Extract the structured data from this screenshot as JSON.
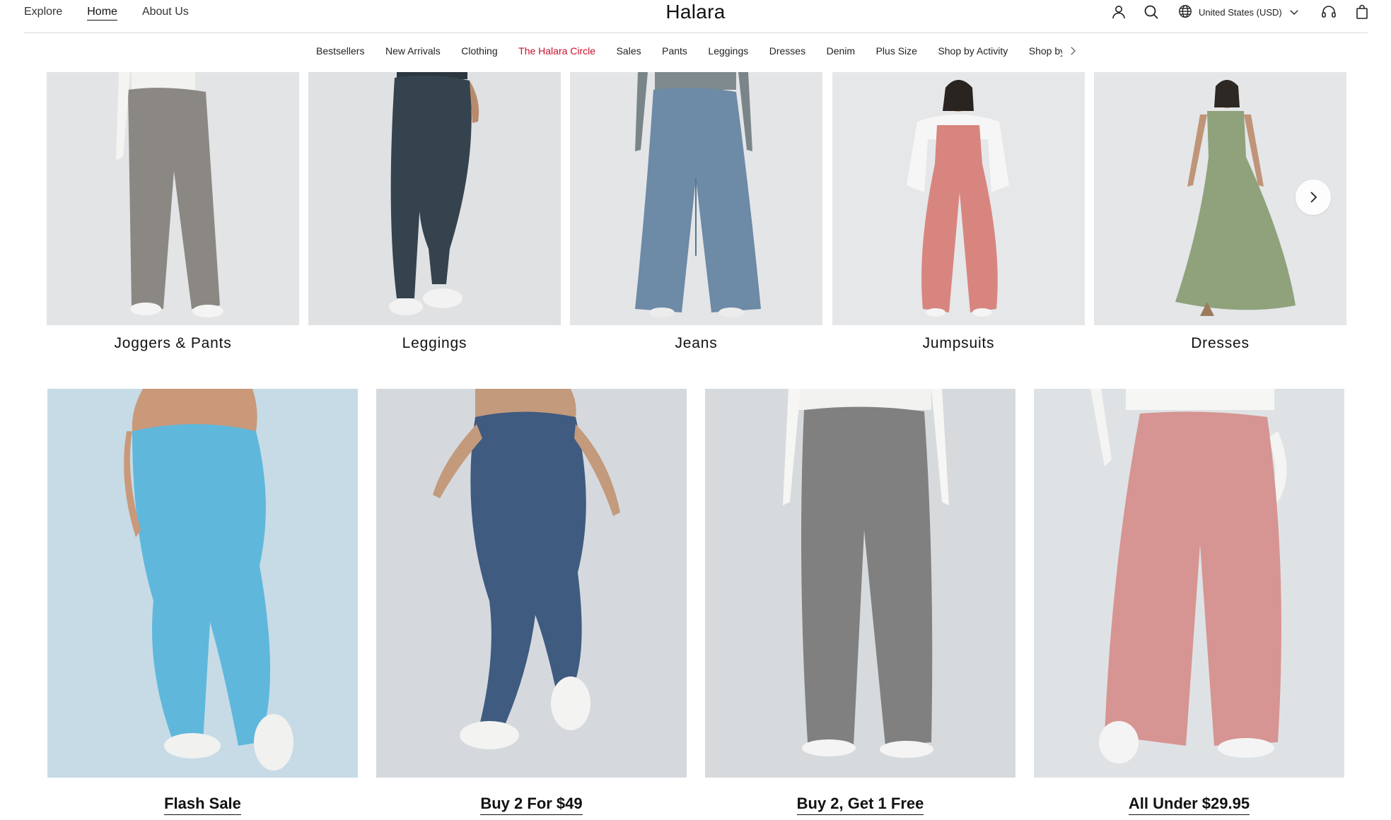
{
  "top_nav": {
    "links": [
      "Explore",
      "Home",
      "About Us"
    ],
    "active": "Home"
  },
  "brand": "Halara",
  "header_actions": {
    "account_icon": "person-icon",
    "search_icon": "search-icon",
    "region_icon": "globe-icon",
    "region_label": "United States (USD)",
    "region_chevron": "chevron-down-icon",
    "support_icon": "headset-icon",
    "cart_icon": "shopping-bag-icon"
  },
  "category_menu": {
    "items": [
      "Bestsellers",
      "New Arrivals",
      "Clothing",
      "The Halara Circle",
      "Sales",
      "Pants",
      "Leggings",
      "Dresses",
      "Denim",
      "Plus Size",
      "Shop by Activity",
      "Shop by"
    ],
    "highlighted": "The Halara Circle",
    "more_icon": "chevron-right-icon"
  },
  "categories": [
    {
      "label": "Joggers & Pants",
      "color": "#8a8782"
    },
    {
      "label": "Leggings",
      "color": "#34434d"
    },
    {
      "label": "Jeans",
      "color": "#6d8aa6"
    },
    {
      "label": "Jumpsuits",
      "color": "#d8857f"
    },
    {
      "label": "Dresses",
      "color": "#8fa27b"
    }
  ],
  "carousel_next_icon": "chevron-right-icon",
  "promos": [
    {
      "label": "Flash Sale",
      "color": "#5fb7dc",
      "bg": "#c6dbe6"
    },
    {
      "label": "Buy 2 For $49",
      "color": "#3f5b80",
      "bg": "#d5d9de"
    },
    {
      "label": "Buy 2, Get 1 Free",
      "color": "#808080",
      "bg": "#d7dadd"
    },
    {
      "label": "All Under $29.95",
      "color": "#d69592",
      "bg": "#dfe2e5"
    }
  ]
}
